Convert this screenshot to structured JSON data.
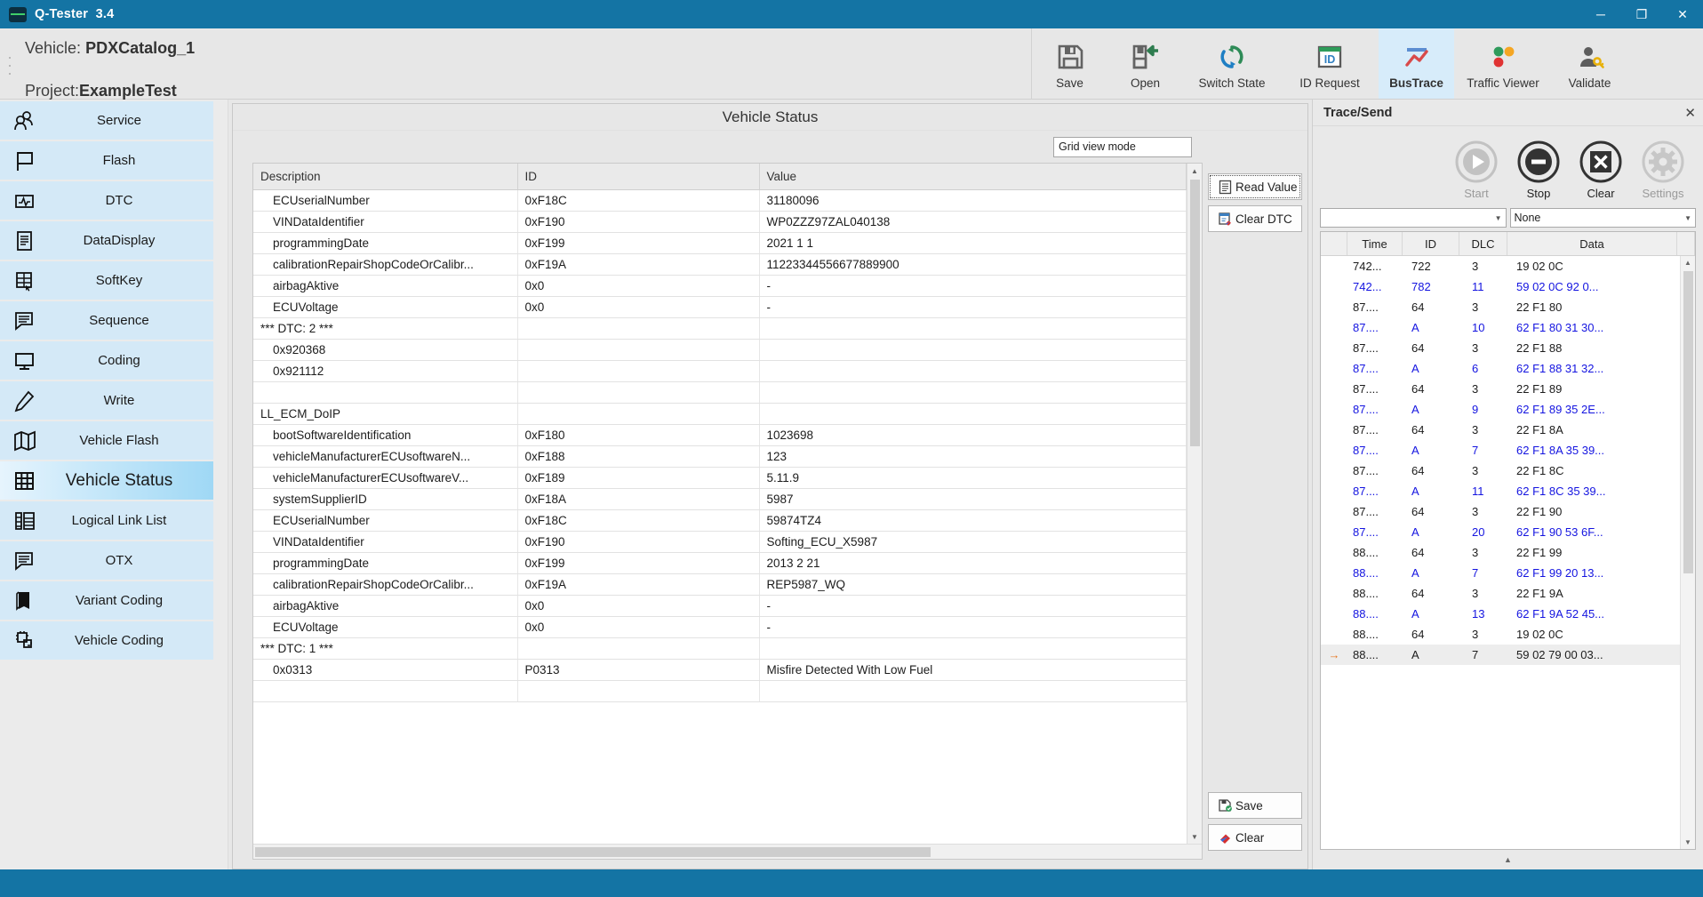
{
  "window": {
    "app_title": "Q-Tester",
    "app_version": "3.4",
    "minimize_label": "─",
    "maximize_label": "❐",
    "close_label": "✕"
  },
  "header": {
    "vehicle_label": "Vehicle:",
    "vehicle_value": "PDXCatalog_1",
    "project_label": "Project:",
    "project_value": "ExampleTest",
    "tools": [
      {
        "label": "Save",
        "icon": "save-icon"
      },
      {
        "label": "Open",
        "icon": "open-icon"
      },
      {
        "label": "Switch State",
        "icon": "switch-state-icon"
      },
      {
        "label": "ID Request",
        "icon": "id-request-icon"
      },
      {
        "label": "BusTrace",
        "icon": "bustrace-icon",
        "active": true
      },
      {
        "label": "Traffic Viewer",
        "icon": "traffic-viewer-icon"
      },
      {
        "label": "Validate",
        "icon": "validate-icon"
      }
    ]
  },
  "sidebar": {
    "items": [
      {
        "label": "Service",
        "icon": "users-icon"
      },
      {
        "label": "Flash",
        "icon": "flag-icon"
      },
      {
        "label": "DTC",
        "icon": "dtc-icon"
      },
      {
        "label": "DataDisplay",
        "icon": "document-icon"
      },
      {
        "label": "SoftKey",
        "icon": "softkey-icon"
      },
      {
        "label": "Sequence",
        "icon": "speech-bubble-icon"
      },
      {
        "label": "Coding",
        "icon": "monitor-icon"
      },
      {
        "label": "Write",
        "icon": "pencil-icon"
      },
      {
        "label": "Vehicle Flash",
        "icon": "map-icon"
      },
      {
        "label": "Vehicle Status",
        "icon": "grid-icon",
        "selected": true
      },
      {
        "label": "Logical Link List",
        "icon": "list-icon"
      },
      {
        "label": "OTX",
        "icon": "speech-bubble-icon"
      },
      {
        "label": "Variant Coding",
        "icon": "book-icon"
      },
      {
        "label": "Vehicle Coding",
        "icon": "node-icon"
      }
    ]
  },
  "main": {
    "panel_title": "Vehicle Status",
    "grid_view_mode": "Grid view mode",
    "buttons": {
      "read_value": "Read Value",
      "clear_dtc": "Clear DTC",
      "save": "Save",
      "clear": "Clear"
    },
    "table": {
      "columns": [
        "Description",
        "ID",
        "Value"
      ],
      "rows": [
        {
          "description": "ECUserialNumber",
          "id": "0xF18C",
          "value": "31180096",
          "indent": true
        },
        {
          "description": "VINDataIdentifier",
          "id": "0xF190",
          "value": "WP0ZZZ97ZAL040138",
          "indent": true
        },
        {
          "description": "programmingDate",
          "id": "0xF199",
          "value": "2021 1 1",
          "indent": true
        },
        {
          "description": "calibrationRepairShopCodeOrCalibr...",
          "id": "0xF19A",
          "value": "11223344556677889900",
          "indent": true
        },
        {
          "description": "airbagAktive",
          "id": "0x0",
          "value": "-",
          "indent": true
        },
        {
          "description": "ECUVoltage",
          "id": "0x0",
          "value": "-",
          "indent": true
        },
        {
          "description": "*** DTC: 2 ***",
          "id": "",
          "value": "",
          "indent": false
        },
        {
          "description": "0x920368",
          "id": "",
          "value": "",
          "indent": true
        },
        {
          "description": "0x921112",
          "id": "",
          "value": "",
          "indent": true
        },
        {
          "description": "",
          "id": "",
          "value": "",
          "indent": false
        },
        {
          "description": "LL_ECM_DoIP",
          "id": "",
          "value": "",
          "indent": false
        },
        {
          "description": "bootSoftwareIdentification",
          "id": "0xF180",
          "value": "1023698",
          "indent": true
        },
        {
          "description": "vehicleManufacturerECUsoftwareN...",
          "id": "0xF188",
          "value": "123",
          "indent": true
        },
        {
          "description": "vehicleManufacturerECUsoftwareV...",
          "id": "0xF189",
          "value": "5.11.9",
          "indent": true
        },
        {
          "description": "systemSupplierID",
          "id": "0xF18A",
          "value": "5987",
          "indent": true
        },
        {
          "description": "ECUserialNumber",
          "id": "0xF18C",
          "value": "59874TZ4",
          "indent": true
        },
        {
          "description": "VINDataIdentifier",
          "id": "0xF190",
          "value": "Softing_ECU_X5987",
          "indent": true
        },
        {
          "description": "programmingDate",
          "id": "0xF199",
          "value": "2013 2 21",
          "indent": true
        },
        {
          "description": "calibrationRepairShopCodeOrCalibr...",
          "id": "0xF19A",
          "value": "REP5987_WQ",
          "indent": true
        },
        {
          "description": "airbagAktive",
          "id": "0x0",
          "value": "-",
          "indent": true
        },
        {
          "description": "ECUVoltage",
          "id": "0x0",
          "value": "-",
          "indent": true
        },
        {
          "description": "*** DTC: 1 ***",
          "id": "",
          "value": "",
          "indent": false
        },
        {
          "description": "0x0313",
          "id": "P0313",
          "value": "Misfire Detected With Low Fuel",
          "indent": true
        },
        {
          "description": "",
          "id": "",
          "value": "",
          "indent": false
        }
      ]
    }
  },
  "dock": {
    "title": "Trace/Send",
    "close_label": "✕",
    "controls": [
      {
        "label": "Start",
        "icon": "play-icon",
        "enabled": false
      },
      {
        "label": "Stop",
        "icon": "stop-icon",
        "enabled": true
      },
      {
        "label": "Clear",
        "icon": "clear-icon",
        "enabled": true
      },
      {
        "label": "Settings",
        "icon": "gear-icon",
        "enabled": false
      }
    ],
    "select_left_value": "",
    "select_right_value": "None",
    "trace": {
      "columns": [
        "Time",
        "ID",
        "DLC",
        "Data"
      ],
      "rows": [
        {
          "marker": "",
          "time": "742...",
          "id": "722",
          "dlc": "3",
          "data": "19 02 0C",
          "kind": "req"
        },
        {
          "marker": "",
          "time": "742...",
          "id": "782",
          "dlc": "11",
          "data": "59 02 0C 92 0...",
          "kind": "resp"
        },
        {
          "marker": "",
          "time": "87....",
          "id": "64",
          "dlc": "3",
          "data": "22 F1 80",
          "kind": "req"
        },
        {
          "marker": "",
          "time": "87....",
          "id": "A",
          "dlc": "10",
          "data": "62 F1 80 31 30...",
          "kind": "resp"
        },
        {
          "marker": "",
          "time": "87....",
          "id": "64",
          "dlc": "3",
          "data": "22 F1 88",
          "kind": "req"
        },
        {
          "marker": "",
          "time": "87....",
          "id": "A",
          "dlc": "6",
          "data": "62 F1 88 31 32...",
          "kind": "resp"
        },
        {
          "marker": "",
          "time": "87....",
          "id": "64",
          "dlc": "3",
          "data": "22 F1 89",
          "kind": "req"
        },
        {
          "marker": "",
          "time": "87....",
          "id": "A",
          "dlc": "9",
          "data": "62 F1 89 35 2E...",
          "kind": "resp"
        },
        {
          "marker": "",
          "time": "87....",
          "id": "64",
          "dlc": "3",
          "data": "22 F1 8A",
          "kind": "req"
        },
        {
          "marker": "",
          "time": "87....",
          "id": "A",
          "dlc": "7",
          "data": "62 F1 8A 35 39...",
          "kind": "resp"
        },
        {
          "marker": "",
          "time": "87....",
          "id": "64",
          "dlc": "3",
          "data": "22 F1 8C",
          "kind": "req"
        },
        {
          "marker": "",
          "time": "87....",
          "id": "A",
          "dlc": "11",
          "data": "62 F1 8C 35 39...",
          "kind": "resp"
        },
        {
          "marker": "",
          "time": "87....",
          "id": "64",
          "dlc": "3",
          "data": "22 F1 90",
          "kind": "req"
        },
        {
          "marker": "",
          "time": "87....",
          "id": "A",
          "dlc": "20",
          "data": "62 F1 90 53 6F...",
          "kind": "resp"
        },
        {
          "marker": "",
          "time": "88....",
          "id": "64",
          "dlc": "3",
          "data": "22 F1 99",
          "kind": "req"
        },
        {
          "marker": "",
          "time": "88....",
          "id": "A",
          "dlc": "7",
          "data": "62 F1 99 20 13...",
          "kind": "resp"
        },
        {
          "marker": "",
          "time": "88....",
          "id": "64",
          "dlc": "3",
          "data": "22 F1 9A",
          "kind": "req"
        },
        {
          "marker": "",
          "time": "88....",
          "id": "A",
          "dlc": "13",
          "data": "62 F1 9A 52 45...",
          "kind": "resp"
        },
        {
          "marker": "",
          "time": "88....",
          "id": "64",
          "dlc": "3",
          "data": "19 02 0C",
          "kind": "req"
        },
        {
          "marker": "→",
          "time": "88....",
          "id": "A",
          "dlc": "7",
          "data": "59 02 79 00 03...",
          "kind": "req",
          "current": true
        }
      ]
    }
  },
  "colors": {
    "accent": "#1474a4",
    "sidebar_item": "#d4e9f7",
    "sidebar_selected": "#9fd8f5",
    "toolbar_active": "#d7ecfa",
    "response_text": "#1414e0",
    "marker": "#e87722"
  }
}
